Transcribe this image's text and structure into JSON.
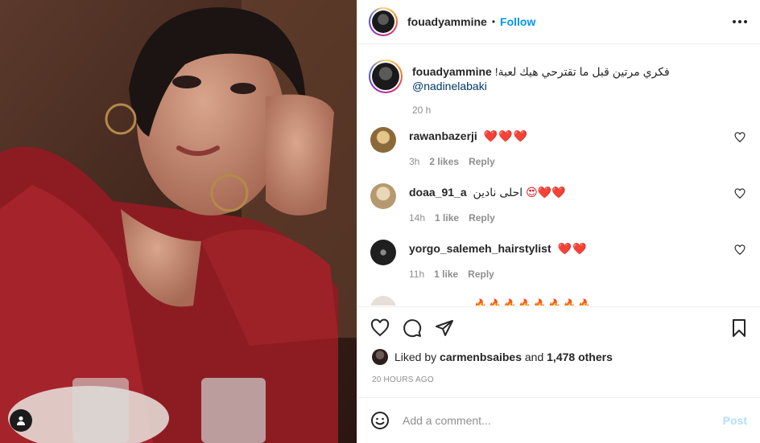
{
  "post": {
    "username": "fouadyammine",
    "dot": "•",
    "follow_label": "Follow"
  },
  "caption": {
    "username": "fouadyammine",
    "text": "فكري مرتين قبل ما تقترحي هيك لعبة!",
    "mention": "@nadinelabaki",
    "time": "20 h"
  },
  "comments": [
    {
      "username": "rawanbazerji",
      "text": "",
      "hearts": "❤️❤️❤️",
      "time": "3h",
      "likes": "2 likes",
      "reply": "Reply",
      "avatar_color": "#c9a86a"
    },
    {
      "username": "doaa_91_a",
      "text": "احلى نادين",
      "hearts": "😍❤️❤️",
      "time": "14h",
      "likes": "1 like",
      "reply": "Reply",
      "avatar_color": "#d8c9a8"
    },
    {
      "username": "yorgo_salemeh_hairstylist",
      "text": "",
      "hearts": "❤️❤️",
      "time": "11h",
      "likes": "1 like",
      "reply": "Reply",
      "avatar_color": "#1f1f1f"
    },
    {
      "username": "",
      "text": "",
      "hearts": "🔥🔥🔥🔥🔥🔥🔥🔥",
      "time": "",
      "likes": "",
      "reply": "",
      "avatar_color": "#e6dfd8"
    }
  ],
  "likes": {
    "prefix": "Liked by",
    "user": "carmenbsaibes",
    "connector": "and",
    "count": "1,478 others"
  },
  "date": "20 HOURS AGO",
  "add_comment": {
    "placeholder": "Add a comment...",
    "post_label": "Post"
  },
  "colors": {
    "accent": "#0095f6",
    "mention": "#00376b",
    "heart": "#e0111b",
    "muted": "#8e8e8e",
    "post_disabled": "#b2dffc"
  }
}
